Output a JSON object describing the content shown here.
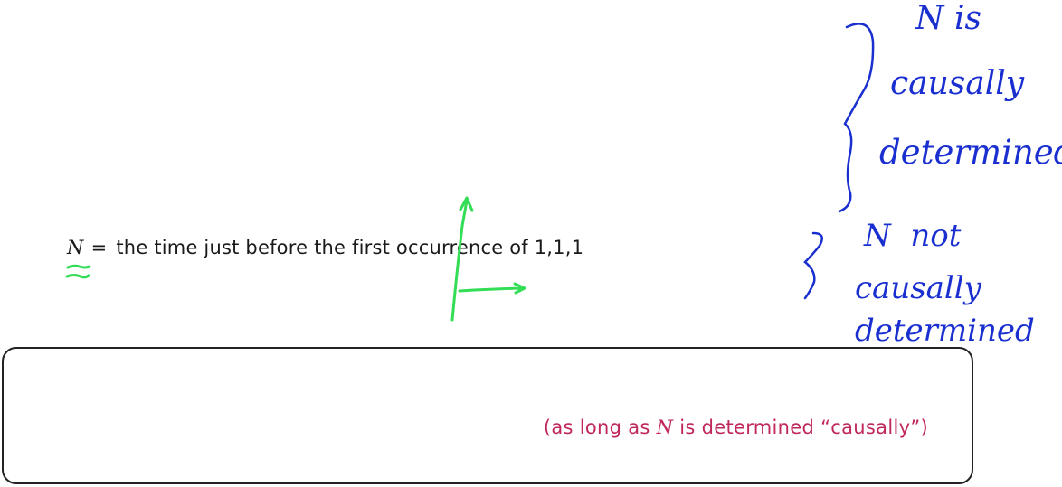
{
  "definition": {
    "var": "N",
    "eq": "=",
    "text": "the time just before the first occurrence of 1,1,1"
  },
  "note": {
    "prefix": "(as long as ",
    "var": "N",
    "suffix": " is determined  “causally”)"
  },
  "annotations": {
    "top": [
      "N is",
      "causally",
      "determined"
    ],
    "bottom": [
      "N  not",
      "causally",
      "determined"
    ]
  },
  "colors": {
    "text": "#1a1a1a",
    "note": "#c0285a",
    "blue_ink": "#1a2fd0",
    "green_ink": "#33dd55",
    "box_border": "#222222"
  }
}
